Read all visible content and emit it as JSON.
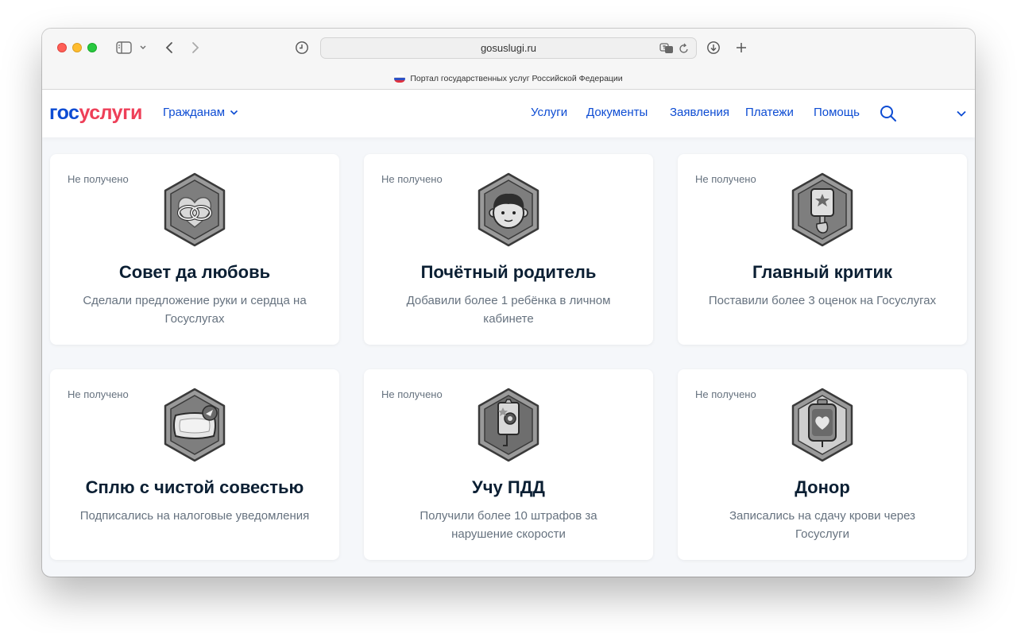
{
  "browser": {
    "url": "gosuslugi.ru",
    "tab_title": "Портал государственных услуг Российской Федерации"
  },
  "header": {
    "logo_part1": "гос",
    "logo_part2": "услуги",
    "audience": "Гражданам",
    "nav": [
      "Услуги",
      "Документы",
      "Заявления",
      "Платежи",
      "Помощь"
    ]
  },
  "colors": {
    "brand_blue": "#0d4cd3",
    "brand_red": "#ee3f58",
    "title": "#0b1f33",
    "muted": "#66727f"
  },
  "achievements": [
    {
      "status": "Не получено",
      "title": "Совет да любовь",
      "description": "Сделали предложение руки и сердца на Госуслугах",
      "icon": "rings-icon"
    },
    {
      "status": "Не получено",
      "title": "Почётный родитель",
      "description": "Добавили более 1 ребёнка в личном кабинете",
      "icon": "child-icon"
    },
    {
      "status": "Не получено",
      "title": "Главный критик",
      "description": "Поставили более 3 оценок на Госуслугах",
      "icon": "rating-sign-icon"
    },
    {
      "status": "Не получено",
      "title": "Сплю с чистой совестью",
      "description": "Подписались на налоговые уведомления",
      "icon": "pillow-icon"
    },
    {
      "status": "Не получено",
      "title": "Учу ПДД",
      "description": "Получили более 10 штрафов за нарушение скорости",
      "icon": "speed-camera-icon"
    },
    {
      "status": "Не получено",
      "title": "Донор",
      "description": "Записались на сдачу крови через Госуслуги",
      "icon": "blood-bag-icon"
    }
  ]
}
